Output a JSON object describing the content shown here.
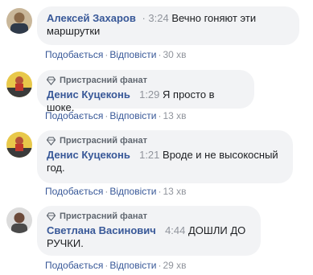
{
  "comments": [
    {
      "fan_badge": "",
      "author": "Алексей Захаров",
      "time": "3:24",
      "text": "Вечно гоняют эти маршрутки",
      "like": "Подобається",
      "reply": "Відповісти",
      "age": "30 хв"
    },
    {
      "fan_badge": "Пристрасний фанат",
      "author": "Денис Куцеконь",
      "time": "1:29",
      "text": "Я просто в шоке.",
      "like": "Подобається",
      "reply": "Відповісти",
      "age": "13 хв"
    },
    {
      "fan_badge": "",
      "author": "Денис Куцеконь",
      "time": "1:21",
      "text": "Вроде и не высокосный год.",
      "like": "Подобається",
      "reply": "Відповісти",
      "age": "13 хв"
    },
    {
      "fan_badge": "Пристрасний фанат",
      "author": "Светлана Васинович",
      "time": "4:44",
      "text": "ДОШЛИ ДО РУЧКИ.",
      "like": "Подобається",
      "reply": "Відповісти",
      "age": "29 хв"
    }
  ],
  "third_comment_badge": "Пристрасний фанат",
  "colors": {
    "name": "#385898",
    "muted": "#90949c",
    "bubble": "#f2f3f5"
  }
}
